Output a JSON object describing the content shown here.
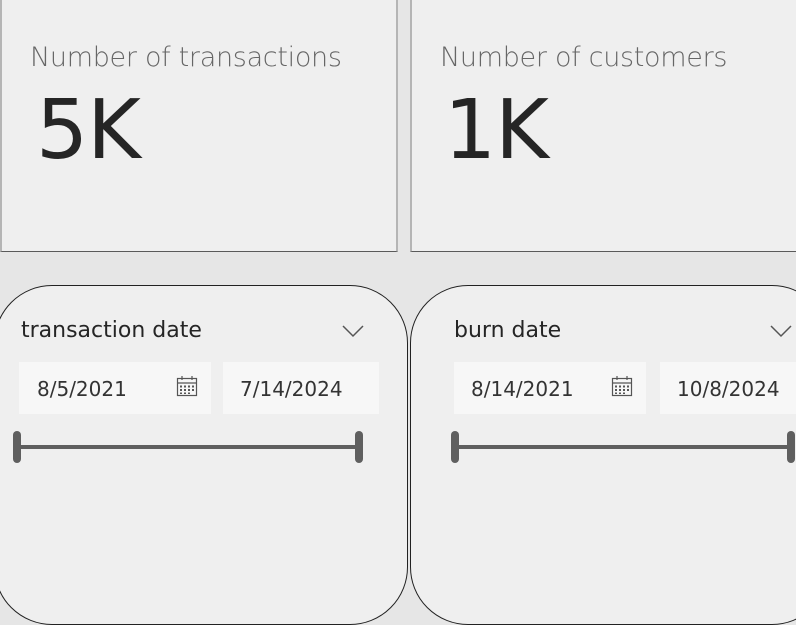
{
  "cards": [
    {
      "title": "Number of transactions",
      "value": "5K"
    },
    {
      "title": "Number of customers",
      "value": "1K"
    }
  ],
  "slicers": [
    {
      "title": "transaction date",
      "start_date": "8/5/2021",
      "end_date": "7/14/2024",
      "icons": {
        "expand": "chevron-down-icon",
        "date_picker": "calendar-icon"
      },
      "range_fraction": [
        0,
        1
      ]
    },
    {
      "title": "burn date",
      "start_date": "8/14/2021",
      "end_date": "10/8/2024",
      "icons": {
        "expand": "chevron-down-icon",
        "date_picker": "calendar-icon"
      },
      "range_fraction": [
        0,
        1
      ]
    }
  ],
  "colors": {
    "card_background": "#efefef",
    "page_background": "#e6e6e6",
    "value_text": "#252525",
    "title_text": "#666666",
    "slider": "#5f5f5f"
  }
}
